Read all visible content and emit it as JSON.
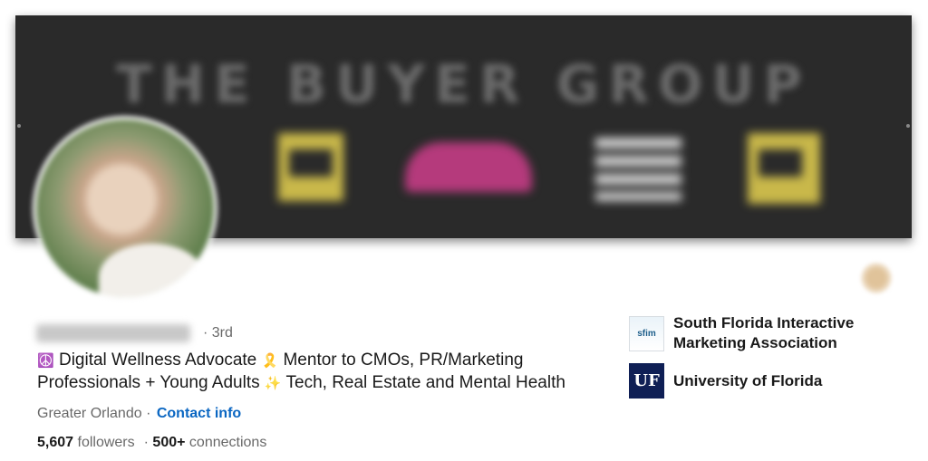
{
  "banner": {
    "title": "THE BUYER GROUP"
  },
  "profile": {
    "degree": "· 3rd",
    "headline": {
      "emoji_1": "☮️",
      "part_1": "Digital Wellness Advocate",
      "emoji_2": "🎗️",
      "part_2": "Mentor to CMOs, PR/Marketing Professionals + Young Adults",
      "emoji_3": "✨",
      "part_3": "Tech, Real Estate and Mental Health"
    },
    "location": "Greater Orlando",
    "separator": "·",
    "contact_link": "Contact info",
    "followers_count": "5,607",
    "followers_label": "followers",
    "connections_sep": "·",
    "connections_count": "500+",
    "connections_label": "connections"
  },
  "organizations": [
    {
      "name": "South Florida Interactive Marketing Association",
      "logo_text": "sfim"
    },
    {
      "name": "University of Florida",
      "logo_text": "UF"
    }
  ],
  "colors": {
    "link": "#0a66c2",
    "uf_navy": "#0f1f55",
    "banner_bg": "#2a2a2a"
  }
}
